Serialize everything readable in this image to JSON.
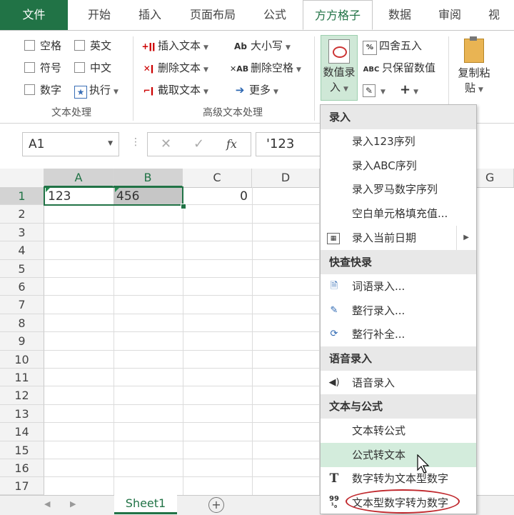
{
  "tabs": [
    {
      "label": "文件",
      "state": "file"
    },
    {
      "label": "开始",
      "state": ""
    },
    {
      "label": "插入",
      "state": ""
    },
    {
      "label": "页面布局",
      "state": ""
    },
    {
      "label": "公式",
      "state": ""
    },
    {
      "label": "方方格子",
      "state": "active"
    },
    {
      "label": "数据",
      "state": ""
    },
    {
      "label": "审阅",
      "state": ""
    },
    {
      "label": "视",
      "state": ""
    }
  ],
  "ribbon": {
    "text_processing": {
      "label": "文本处理",
      "space": "空格",
      "english": "英文",
      "symbol": "符号",
      "chinese": "中文",
      "number": "数字",
      "execute": "执行"
    },
    "advanced_text": {
      "label": "高级文本处理",
      "insert_text": "插入文本",
      "delete_text": "删除文本",
      "extract_text": "截取文本",
      "case": "大小写",
      "remove_spaces": "删除空格",
      "more": "更多"
    },
    "numeric": {
      "value_entry_line1": "数值录",
      "value_entry_line2": "入",
      "round": "四舍五入",
      "keep_values": "只保留数值",
      "copy_paste_line1": "复制粘",
      "copy_paste_line2": "贴"
    }
  },
  "formula_bar": {
    "name_box": "A1",
    "content": "'123",
    "fx": "fx"
  },
  "grid": {
    "columns": [
      "A",
      "B",
      "C",
      "D",
      "G"
    ],
    "rows": [
      "1",
      "2",
      "3",
      "4",
      "5",
      "6",
      "7",
      "8",
      "9",
      "10",
      "11",
      "12",
      "13",
      "14",
      "15",
      "16",
      "17"
    ],
    "cells": {
      "A1": "123",
      "B1": "456",
      "C1": "0"
    }
  },
  "sheet": {
    "tab": "Sheet1",
    "add": "+"
  },
  "menu": {
    "sections": [
      {
        "title": "录入",
        "items": [
          {
            "label": "录入123序列",
            "icon": "",
            "submenu": false,
            "highlighted": false
          },
          {
            "label": "录入ABC序列",
            "icon": "",
            "submenu": false,
            "highlighted": false
          },
          {
            "label": "录入罗马数字序列",
            "icon": "",
            "submenu": false,
            "highlighted": false
          },
          {
            "label": "空白单元格填充值...",
            "icon": "",
            "submenu": false,
            "highlighted": false
          },
          {
            "label": "录入当前日期",
            "icon": "calendar-icon",
            "submenu": true,
            "highlighted": false
          }
        ]
      },
      {
        "title": "快查快录",
        "items": [
          {
            "label": "词语录入...",
            "icon": "word-entry-icon",
            "submenu": false,
            "highlighted": false
          },
          {
            "label": "整行录入...",
            "icon": "row-entry-icon",
            "submenu": false,
            "highlighted": false
          },
          {
            "label": "整行补全...",
            "icon": "row-complete-icon",
            "submenu": false,
            "highlighted": false
          }
        ]
      },
      {
        "title": "语音录入",
        "items": [
          {
            "label": "语音录入",
            "icon": "speaker-icon",
            "submenu": false,
            "highlighted": false
          }
        ]
      },
      {
        "title": "文本与公式",
        "items": [
          {
            "label": "文本转公式",
            "icon": "",
            "submenu": false,
            "highlighted": false
          },
          {
            "label": "公式转文本",
            "icon": "",
            "submenu": false,
            "highlighted": true
          },
          {
            "label": "数字转为文本型数字",
            "icon": "text-t-icon",
            "submenu": false,
            "highlighted": false
          },
          {
            "label": "文本型数字转为数字",
            "icon": "number-convert-icon",
            "submenu": false,
            "highlighted": false
          }
        ]
      }
    ]
  },
  "colors": {
    "accent": "#217346",
    "menu_highlight": "#d3ecdc",
    "annotation": "#c0282d"
  }
}
